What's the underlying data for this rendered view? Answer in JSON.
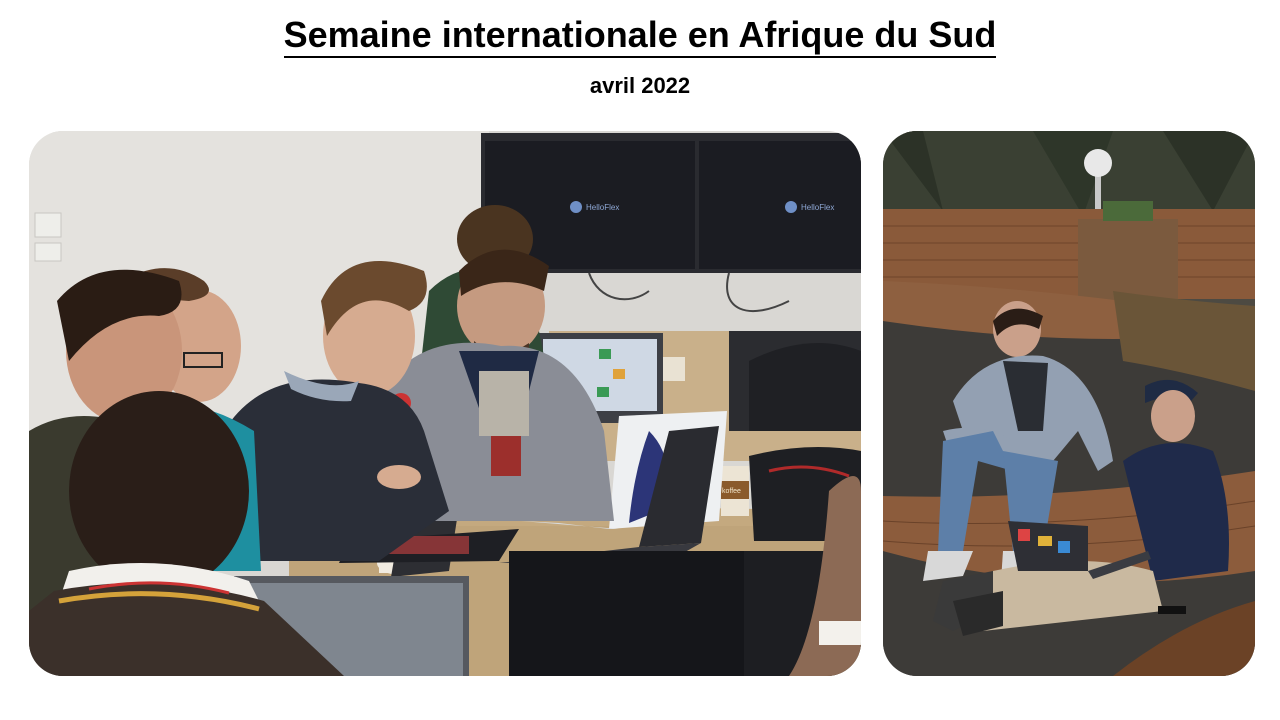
{
  "page": {
    "title": "Semaine internationale en Afrique du Sud",
    "subtitle": "avril 2022"
  },
  "photos": {
    "left": {
      "screen_logo_1": "HelloFlex",
      "screen_logo_2": "HelloFlex",
      "cup_label": "koffee"
    },
    "right": {}
  }
}
